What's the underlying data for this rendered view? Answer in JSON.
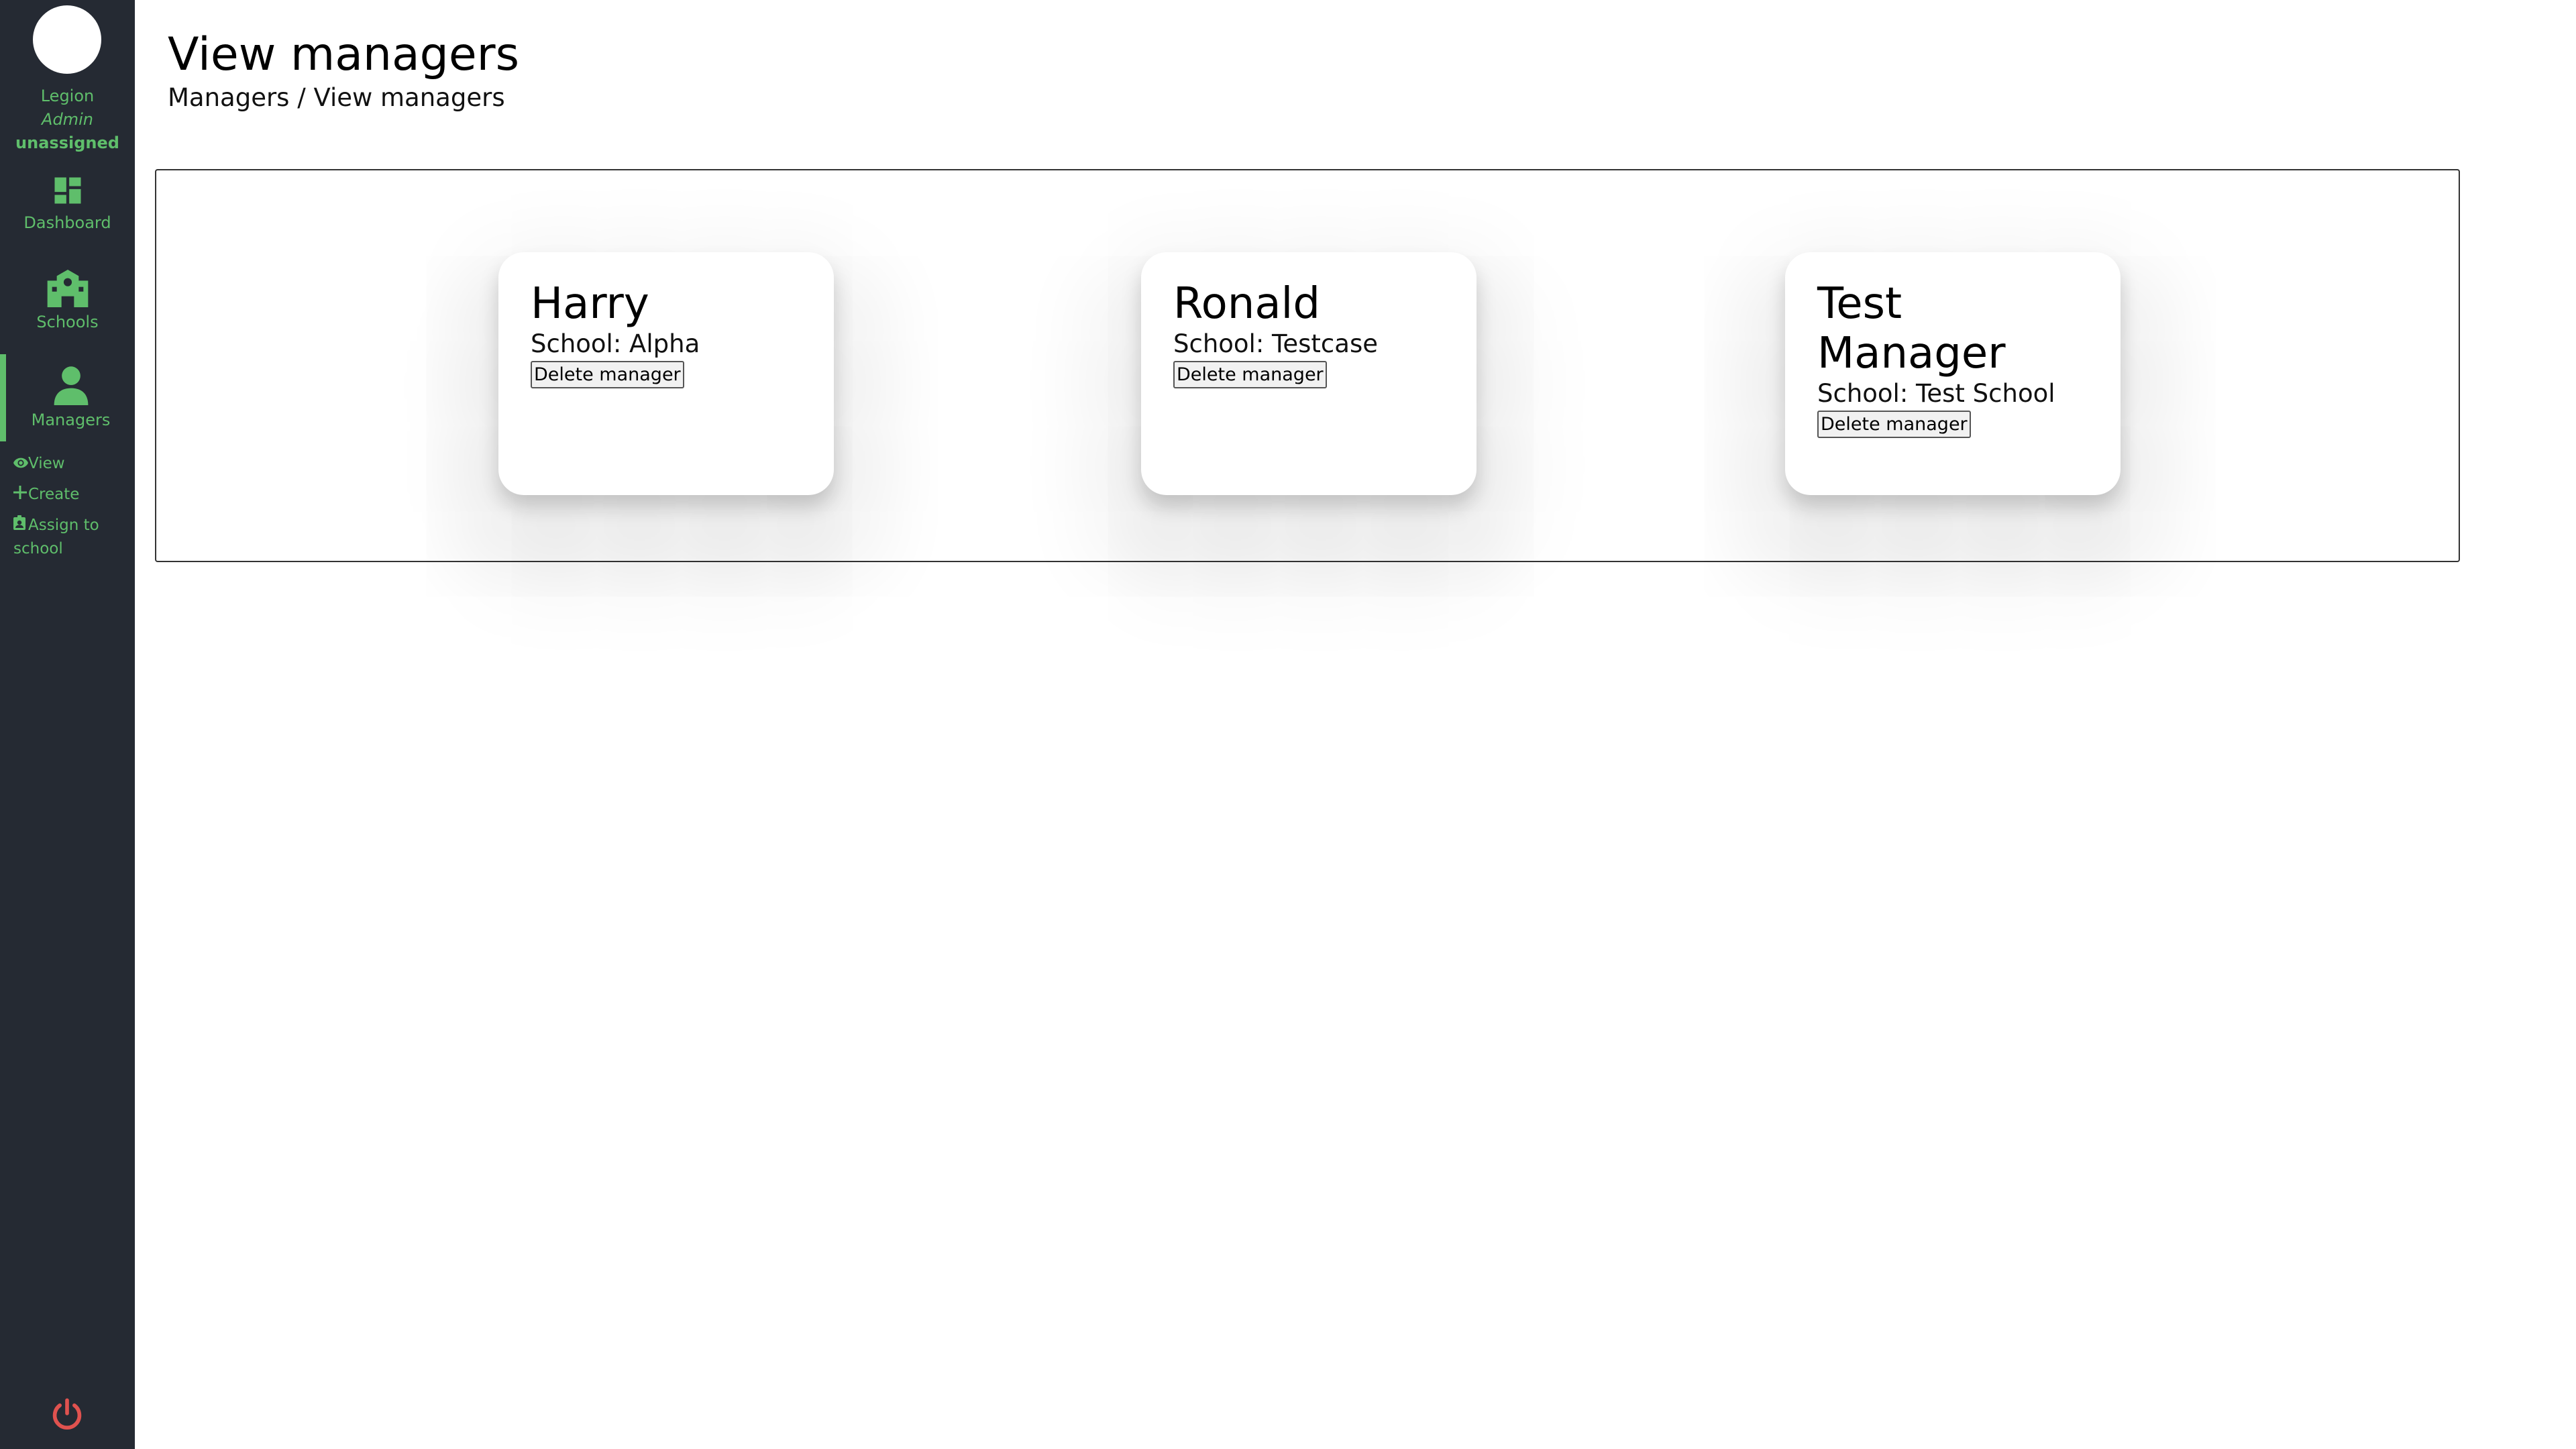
{
  "sidebar": {
    "user": {
      "name": "Legion",
      "role": "Admin",
      "status": "unassigned"
    },
    "nav": [
      {
        "label": "Dashboard",
        "icon": "dashboard-icon"
      },
      {
        "label": "Schools",
        "icon": "school-icon"
      },
      {
        "label": "Managers",
        "icon": "person-icon",
        "active": true
      }
    ],
    "subnav": [
      {
        "label": "View",
        "icon": "eye-icon"
      },
      {
        "label": "Create",
        "icon": "plus-icon"
      },
      {
        "label": "Assign to school",
        "icon": "badge-icon"
      }
    ],
    "power_icon": "power-icon"
  },
  "header": {
    "title": "View managers",
    "breadcrumb": "Managers / View managers"
  },
  "managers": [
    {
      "name": "Harry",
      "school": "School: Alpha",
      "delete_label": "Delete manager"
    },
    {
      "name": "Ronald",
      "school": "School: Testcase",
      "delete_label": "Delete manager"
    },
    {
      "name": "Test Manager",
      "school": "School: Test School",
      "delete_label": "Delete manager"
    }
  ],
  "colors": {
    "sidebar_bg": "#252a33",
    "accent": "#5fbe6b",
    "power": "#e0524f"
  }
}
